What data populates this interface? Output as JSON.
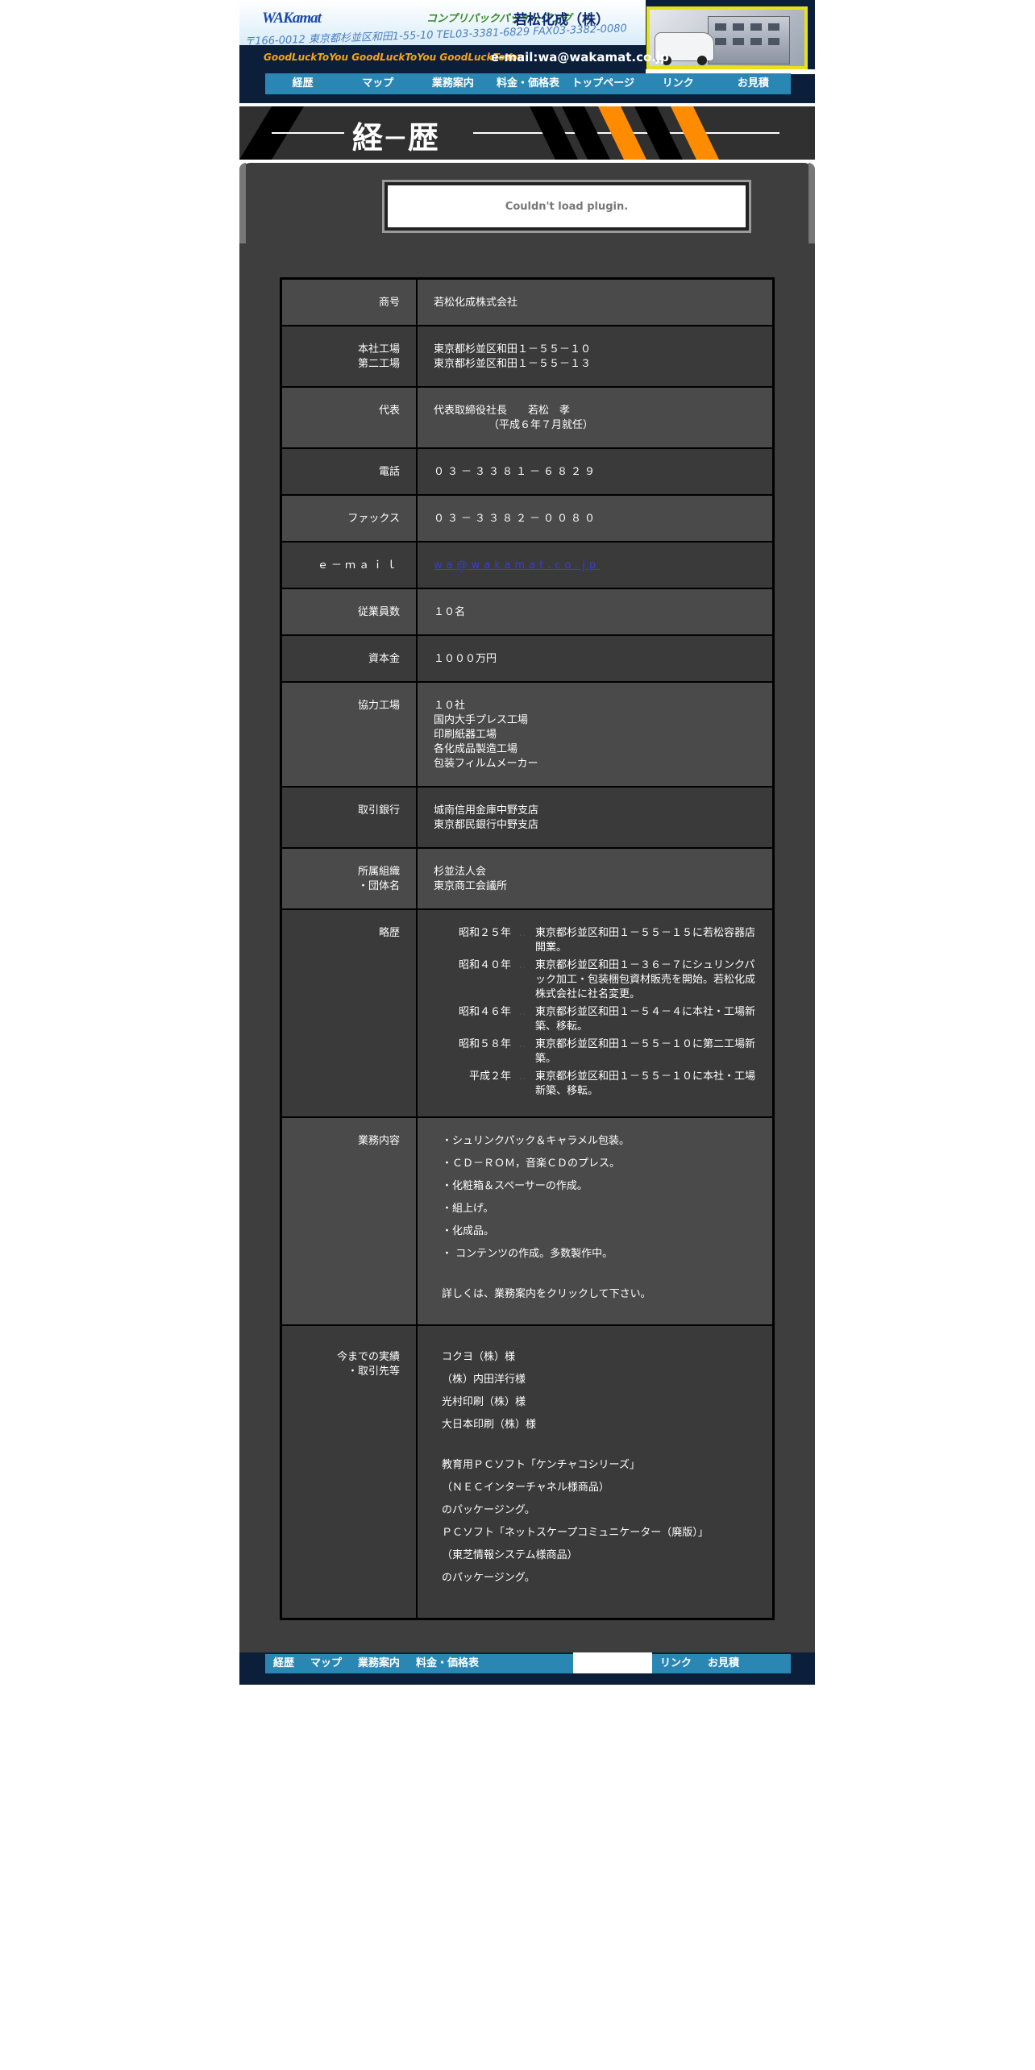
{
  "header": {
    "logo": "WAKamat",
    "tagline": "コンプリパックパッケージング",
    "company": "若松化成（株）",
    "address_strip": "〒166-0012 東京都杉並区和田1-55-10 TEL03-3381-6829 FAX03-3382-0080",
    "slogan": "GoodLuckToYou GoodLuckToYou GoodLuckToYou",
    "email": "e-mail:wa@wakamat.co.jp"
  },
  "nav": [
    "経歴",
    "マップ",
    "業務案内",
    "料金・価格表",
    "トップページ",
    "リンク",
    "お見積"
  ],
  "page_title": "経─歴",
  "plugin_message": "Couldn't load plugin.",
  "info": {
    "company_label": "商号",
    "company_value": "若松化成株式会社",
    "factory_label_1": "本社工場",
    "factory_label_2": "第二工場",
    "factory_value_1": "東京都杉並区和田１－５５－１０",
    "factory_value_2": "東京都杉並区和田１－５５－１３",
    "rep_label": "代表",
    "rep_value_1": "代表取締役社長　　若松　孝",
    "rep_value_2": "（平成６年７月就任）",
    "tel_label": "電話",
    "tel_value": "０３－３３８１－６８２９",
    "fax_label": "ファックス",
    "fax_value": "０３－３３８２－００８０",
    "email_label": "ｅ－ｍａｉｌ",
    "email_value": "wa@wakamat.co.jp",
    "staff_label": "従業員数",
    "staff_value": "１０名",
    "capital_label": "資本金",
    "capital_value": "１０００万円",
    "partners_label": "協力工場",
    "partners_values": [
      "１０社",
      "国内大手プレス工場",
      "印刷紙器工場",
      "各化成品製造工場",
      "包装フィルムメーカー"
    ],
    "bank_label": "取引銀行",
    "bank_values": [
      "城南信用金庫中野支店",
      "東京都民銀行中野支店"
    ],
    "org_label_1": "所属組織",
    "org_label_2": "・団体名",
    "org_values": [
      "杉並法人会",
      "東京商工会議所"
    ],
    "history_label": "略歴",
    "history": [
      {
        "year": "昭和２５年",
        "text": "東京都杉並区和田１－５５－１５に若松容器店開業。"
      },
      {
        "year": "昭和４０年",
        "text": "東京都杉並区和田１－３６－７にシュリンクパック加工・包装梱包資材販売を開始。若松化成株式会社に社名変更。"
      },
      {
        "year": "昭和４６年",
        "text": "東京都杉並区和田１－５４－４に本社・工場新築、移転。"
      },
      {
        "year": "昭和５８年",
        "text": "東京都杉並区和田１－５５－１０に第二工場新築。"
      },
      {
        "year": "平成２年",
        "text": "東京都杉並区和田１－５５－１０に本社・工場新築、移転。"
      }
    ],
    "business_label": "業務内容",
    "business_values": [
      "・シュリンクパック＆キャラメル包装。",
      "・ＣＤ－ＲＯＭ，音楽ＣＤのプレス。",
      "・化粧箱＆スペーサーの作成。",
      "・組上げ。",
      "・化成品。",
      "・ コンテンツの作成。多数製作中。"
    ],
    "business_note": "詳しくは、業務案内をクリックして下さい。",
    "clients_label_1": "今までの実績",
    "clients_label_2": "・取引先等",
    "clients_values": [
      "コクヨ（株）様",
      "（株）内田洋行様",
      "光村印刷（株）様",
      "大日本印刷（株）様"
    ],
    "clients_project_1": [
      "教育用ＰＣソフト「ケンチャコシリーズ」",
      "（ＮＥＣインターチャネル様商品）",
      "のパッケージング。"
    ],
    "clients_project_2": [
      "ＰＣソフト「ネットスケープコミュニケーター（廃版）」",
      "（東芝情報システム様商品）",
      "のパッケージング。"
    ]
  },
  "footer_nav_left": [
    "経歴",
    "マップ",
    "業務案内",
    "料金・価格表"
  ],
  "footer_nav_right": [
    "リンク",
    "お見積"
  ]
}
